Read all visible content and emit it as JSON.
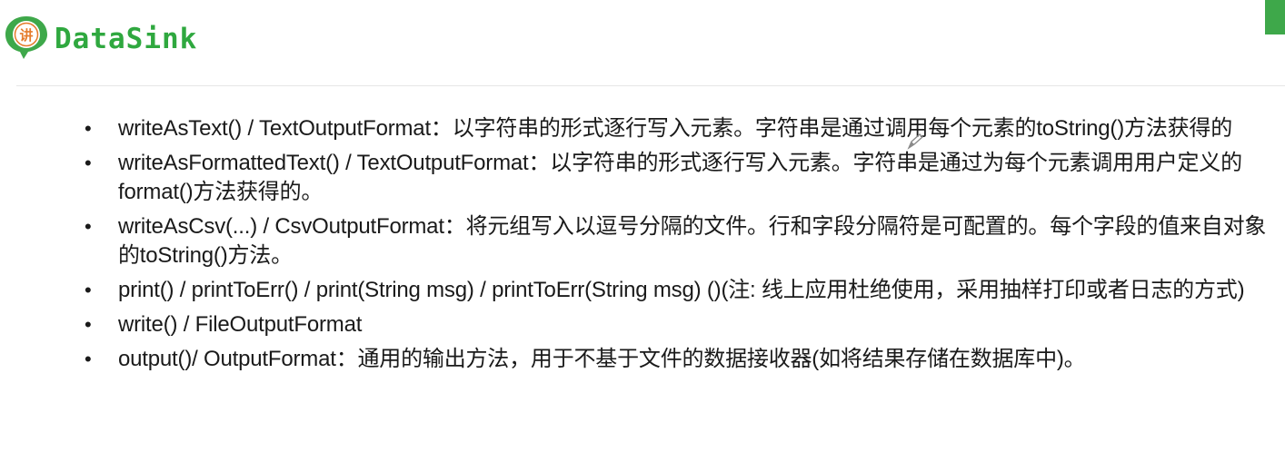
{
  "header": {
    "title": "DataSink",
    "logo_icon": "chat-bubble-logo-icon",
    "logo_glyph": "讲",
    "accent_color": "#2fa83f"
  },
  "items": [
    {
      "text": "writeAsText() / TextOutputFormat：以字符串的形式逐行写入元素。字符串是通过调用每个元素的toString()方法获得的"
    },
    {
      "text": "writeAsFormattedText() / TextOutputFormat：以字符串的形式逐行写入元素。字符串是通过为每个元素调用用户定义的format()方法获得的。"
    },
    {
      "text": "writeAsCsv(...) / CsvOutputFormat：将元组写入以逗号分隔的文件。行和字段分隔符是可配置的。每个字段的值来自对象的toString()方法。"
    },
    {
      "text": "print() / printToErr() / print(String msg) / printToErr(String msg) ()(注: 线上应用杜绝使用，采用抽样打印或者日志的方式)"
    },
    {
      "text": "write() / FileOutputFormat"
    },
    {
      "text": "output()/ OutputFormat：通用的输出方法，用于不基于文件的数据接收器(如将结果存储在数据库中)。"
    }
  ]
}
